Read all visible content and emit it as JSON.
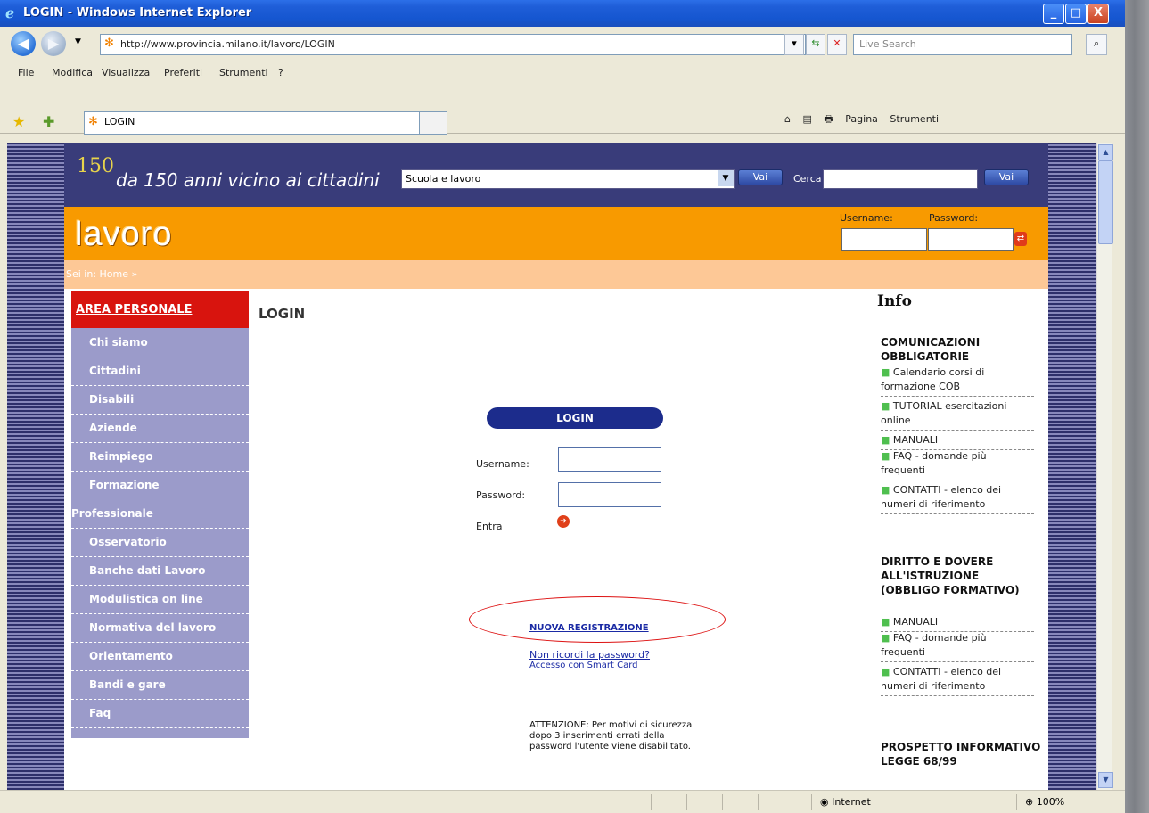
{
  "window": {
    "title": "LOGIN - Windows Internet Explorer",
    "min_symbol": "_",
    "max_symbol": "□",
    "close_symbol": "X"
  },
  "address_bar": {
    "url": "http://www.provincia.milano.it/lavoro/LOGIN",
    "search_placeholder": "Live Search"
  },
  "menu": [
    "File",
    "Modifica",
    "Visualizza",
    "Preferiti",
    "Strumenti",
    "?"
  ],
  "tab": {
    "label": "LOGIN"
  },
  "command_bar": {
    "home": "⌂",
    "pagina": "Pagina",
    "strumenti": "Strumenti"
  },
  "page_header": {
    "anniversary": "da 150 anni vicino ai cittadini",
    "badge": "150",
    "select_value": "Scuola e lavoro",
    "vai_label": "Vai",
    "cerca_label": "Cerca",
    "vai2_label": "Vai"
  },
  "orange_band": {
    "section_title": "lavoro",
    "username_label": "Username:",
    "password_label": "Password:"
  },
  "breadcrumb": "Sei in: Home »",
  "left_menu": {
    "header": "AREA PERSONALE",
    "items": [
      "Chi siamo",
      "Cittadini",
      "Disabili",
      "Aziende",
      "Reimpiego",
      "Formazione",
      "Professionale",
      "Osservatorio",
      "Banche dati Lavoro",
      "Modulistica on line",
      "Normativa del lavoro",
      "Orientamento",
      "Bandi e gare",
      "Faq"
    ]
  },
  "center": {
    "page_title": "LOGIN",
    "login_bar": "LOGIN",
    "username_label": "Username:",
    "password_label": "Password:",
    "entra_label": "Entra",
    "nuova_registrazione": "NUOVA REGISTRAZIONE",
    "non_ricordi": "Non ricordi la password?",
    "smart_card": "Accesso con Smart Card",
    "attenzione": "ATTENZIONE: Per motivi di sicurezza dopo 3 inserimenti errati della password l'utente viene disabilitato."
  },
  "right_column": {
    "info_title": "Info",
    "section1_title": "COMUNICAZIONI OBBLIGATORIE",
    "section1_links": [
      "Calendario corsi di formazione COB",
      "TUTORIAL esercitazioni online",
      "MANUALI",
      "FAQ - domande più frequenti",
      "CONTATTI - elenco dei numeri di riferimento"
    ],
    "section2_title": "DIRITTO E DOVERE ALL'ISTRUZIONE (OBBLIGO FORMATIVO)",
    "section2_links": [
      "MANUALI",
      "FAQ - domande più frequenti",
      "CONTATTI - elenco dei numeri di riferimento"
    ],
    "section3_title": "PROSPETTO INFORMATIVO LEGGE 68/99"
  },
  "status_bar": {
    "zone": "Internet",
    "zoom": "100%"
  },
  "colors": {
    "title_bar": "#1f5ed8",
    "header_bg": "#393c7a",
    "orange": "#f89a00",
    "breadcrumb_band": "#fdc896",
    "menu_bg": "#9b9bca",
    "area_personale": "#d8140e",
    "login_bar": "#1c2c8c",
    "highlight_ellipse": "#dd1111"
  }
}
